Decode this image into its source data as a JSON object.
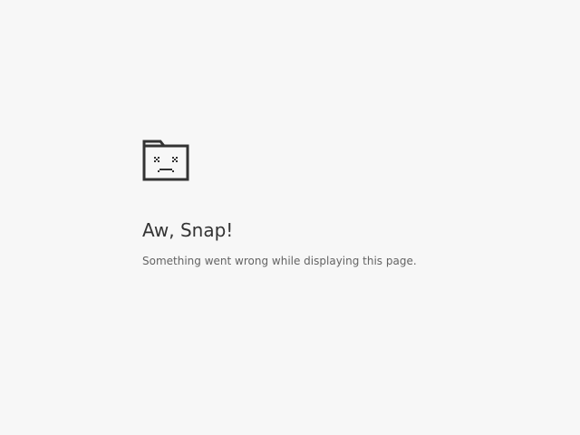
{
  "error_page": {
    "icon": "sad-tab-icon",
    "title": "Aw, Snap!",
    "message": "Something went wrong while displaying this page."
  },
  "colors": {
    "background": "#f7f7f7",
    "icon": "#333333",
    "title": "#333333",
    "message": "#646464"
  }
}
